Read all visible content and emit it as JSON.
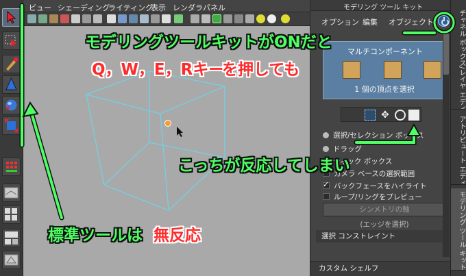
{
  "menubar": {
    "items": [
      "ビュー",
      "シェーディング",
      "ライティング",
      "表示",
      "レンダラ",
      "パネル"
    ]
  },
  "panel": {
    "title": "モデリング ツール キット",
    "menu": [
      "オプション",
      "編集",
      "オブジェクト"
    ],
    "component_label": "マルチコンポーネント",
    "vertex_status": "1 個の頂点を選択",
    "options": [
      {
        "type": "radio",
        "label": "選択/セレクション ボックス"
      },
      {
        "type": "radio",
        "label": "ドラッグ"
      },
      {
        "type": "radio",
        "label": "ティック ボックス"
      },
      {
        "type": "check",
        "checked": false,
        "label": "カメラ ベースの選択範囲"
      },
      {
        "type": "check",
        "checked": true,
        "label": "バックフェースをハイライト"
      },
      {
        "type": "check",
        "checked": false,
        "label": "ループ/リングをプレビュー"
      }
    ],
    "symmetry_button": "シンメトリの軸",
    "edge_hint": "(エッジを選択)",
    "constraint_header": "選択 コンストレイント",
    "custom_shelf": "カスタム シェルフ"
  },
  "side_tabs": [
    "チャネル ボックス/レイヤ エディタ",
    "アトリビュート エディタ",
    "モデリング ツール キット"
  ],
  "annotations": {
    "toolkit_on": "モデリングツールキットがONだと",
    "keys": "Q，W，E，Rキー",
    "keys_suffix": "を押しても",
    "reacts": "こっちが反応してしまい",
    "standard_tools": "標準ツールは",
    "no_reaction_red": "無反応"
  },
  "colors": {
    "annotation_green": "#4dff62",
    "annotation_red": "#ff2b2b",
    "wireframe": "#6fd3e8",
    "viewport_bg": "#a9a9a9",
    "component_box": "#5a7fa3"
  },
  "icons": {
    "left_tools": [
      "select-arrow-icon",
      "lasso-icon",
      "paint-select-icon",
      "move-icon",
      "rotate-icon",
      "scale-icon",
      "component-grid-icon"
    ],
    "selection_tools": [
      "marquee-select-icon",
      "move-icon",
      "rotate-icon",
      "scale-icon"
    ]
  }
}
